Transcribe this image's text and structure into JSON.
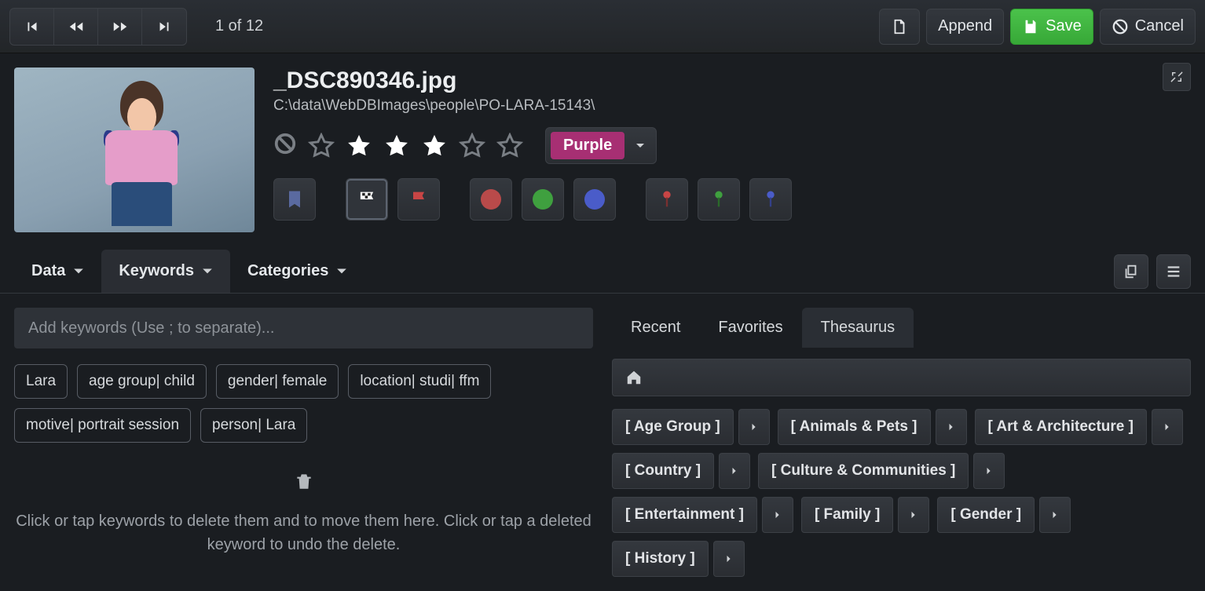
{
  "nav": {
    "counter": "1 of 12"
  },
  "actions": {
    "append": "Append",
    "save": "Save",
    "cancel": "Cancel"
  },
  "file": {
    "name": "_DSC890346.jpg",
    "path": "C:\\data\\WebDBImages\\people\\PO-LARA-15143\\",
    "rating_filled": 3,
    "rating_total": 5,
    "color_label": "Purple",
    "color_hex": "#a72f73"
  },
  "tabs": {
    "data": "Data",
    "keywords": "Keywords",
    "categories": "Categories",
    "active": "keywords"
  },
  "keywords": {
    "placeholder": "Add keywords (Use ; to separate)...",
    "items": [
      "Lara",
      "age group| child",
      "gender| female",
      "location| studi| ffm",
      "motive| portrait session",
      "person| Lara"
    ],
    "trash_hint": "Click or tap keywords to delete them and to move them here. Click or tap a deleted keyword to undo the delete."
  },
  "thesaurus": {
    "tabs": {
      "recent": "Recent",
      "favorites": "Favorites",
      "thesaurus": "Thesaurus",
      "active": "thesaurus"
    },
    "categories": [
      "[ Age Group ]",
      "[ Animals & Pets ]",
      "[ Art & Architecture ]",
      "[ Country ]",
      "[ Culture & Communities ]",
      "[ Entertainment ]",
      "[ Family ]",
      "[ Gender ]",
      "[ History ]"
    ]
  }
}
